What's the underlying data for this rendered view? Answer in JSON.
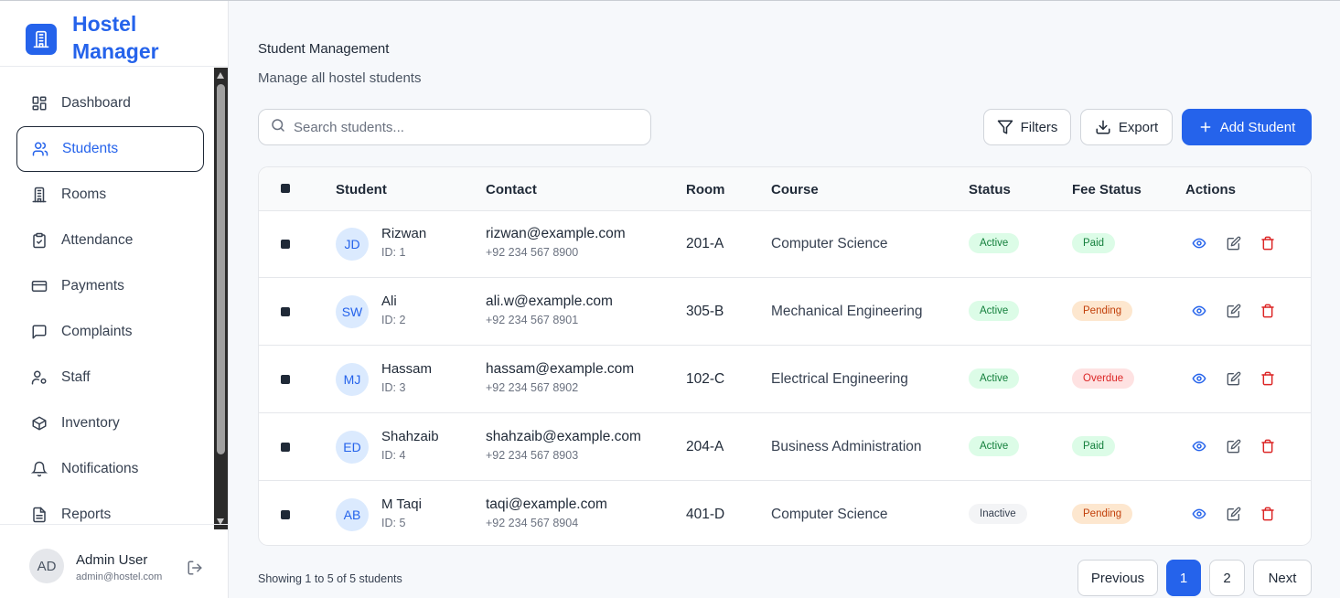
{
  "brand": {
    "title": "Hostel Manager",
    "logo_icon": "building-icon"
  },
  "sidebar": {
    "items": [
      {
        "label": "Dashboard",
        "icon": "dashboard-icon",
        "active": false
      },
      {
        "label": "Students",
        "icon": "users-icon",
        "active": true
      },
      {
        "label": "Rooms",
        "icon": "building-icon",
        "active": false
      },
      {
        "label": "Attendance",
        "icon": "clipboard-check-icon",
        "active": false
      },
      {
        "label": "Payments",
        "icon": "credit-card-icon",
        "active": false
      },
      {
        "label": "Complaints",
        "icon": "message-square-icon",
        "active": false
      },
      {
        "label": "Staff",
        "icon": "user-key-icon",
        "active": false
      },
      {
        "label": "Inventory",
        "icon": "box-icon",
        "active": false
      },
      {
        "label": "Notifications",
        "icon": "bell-icon",
        "active": false
      },
      {
        "label": "Reports",
        "icon": "file-text-icon",
        "active": false
      }
    ]
  },
  "user": {
    "initials": "AD",
    "name": "Admin User",
    "email": "admin@hostel.com"
  },
  "header": {
    "title": "Student Management",
    "subtitle": "Manage all hostel students"
  },
  "search": {
    "placeholder": "Search students..."
  },
  "toolbar": {
    "filters_label": "Filters",
    "export_label": "Export",
    "add_label": "Add Student"
  },
  "table": {
    "columns": [
      "Student",
      "Contact",
      "Room",
      "Course",
      "Status",
      "Fee Status",
      "Actions"
    ],
    "rows": [
      {
        "initials": "JD",
        "name": "Rizwan",
        "id": "ID: 1",
        "email": "rizwan@example.com",
        "phone": "+92 234 567 8900",
        "room": "201-A",
        "course": "Computer Science",
        "status": "Active",
        "fee": "Paid"
      },
      {
        "initials": "SW",
        "name": "Ali",
        "id": "ID: 2",
        "email": "ali.w@example.com",
        "phone": "+92 234 567 8901",
        "room": "305-B",
        "course": "Mechanical Engineering",
        "status": "Active",
        "fee": "Pending"
      },
      {
        "initials": "MJ",
        "name": "Hassam",
        "id": "ID: 3",
        "email": "hassam@example.com",
        "phone": "+92 234 567 8902",
        "room": "102-C",
        "course": "Electrical Engineering",
        "status": "Active",
        "fee": "Overdue"
      },
      {
        "initials": "ED",
        "name": "Shahzaib",
        "id": "ID: 4",
        "email": "shahzaib@example.com",
        "phone": "+92 234 567 8903",
        "room": "204-A",
        "course": "Business Administration",
        "status": "Active",
        "fee": "Paid"
      },
      {
        "initials": "AB",
        "name": "M Taqi",
        "id": "ID: 5",
        "email": "taqi@example.com",
        "phone": "+92 234 567 8904",
        "room": "401-D",
        "course": "Computer Science",
        "status": "Inactive",
        "fee": "Pending"
      }
    ]
  },
  "pagination": {
    "summary": "Showing 1 to 5 of 5 students",
    "previous": "Previous",
    "pages": [
      "1",
      "2"
    ],
    "current": "1",
    "next": "Next"
  },
  "colors": {
    "accent": "#2563eb",
    "danger": "#dc2626"
  }
}
